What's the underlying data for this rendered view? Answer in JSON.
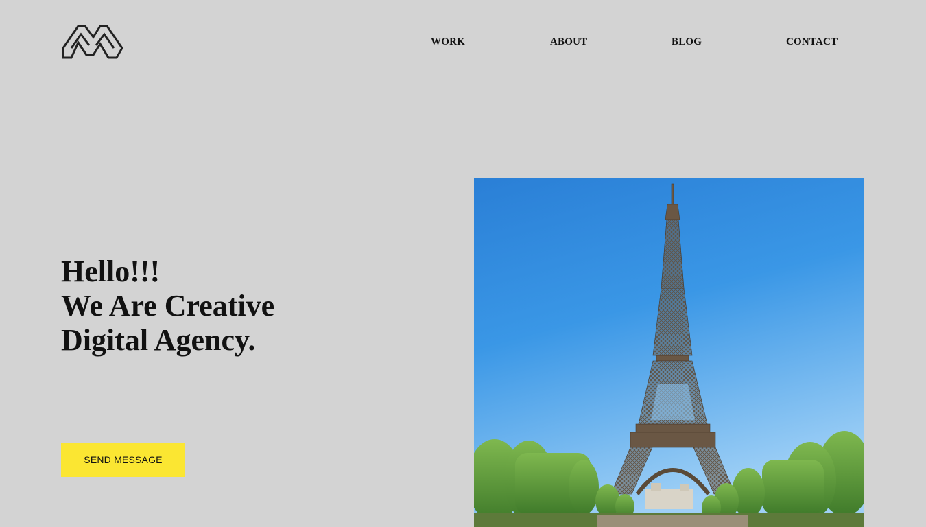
{
  "brand": {
    "logo_icon": "stacked-chevron-logo-icon",
    "logo_color": "#222222"
  },
  "nav": {
    "items": [
      {
        "label": "WORK"
      },
      {
        "label": "ABOUT"
      },
      {
        "label": "BLOG"
      },
      {
        "label": "CONTACT"
      }
    ]
  },
  "hero": {
    "heading_line_1": "Hello!!!",
    "heading_line_2": "We Are Creative",
    "heading_line_3": "Digital Agency.",
    "cta_label": "SEND MESSAGE",
    "cta_color": "#fbe632",
    "image_subject": "eiffel-tower-photo"
  },
  "colors": {
    "background": "#d3d3d3",
    "text": "#111111",
    "accent": "#fbe632"
  }
}
